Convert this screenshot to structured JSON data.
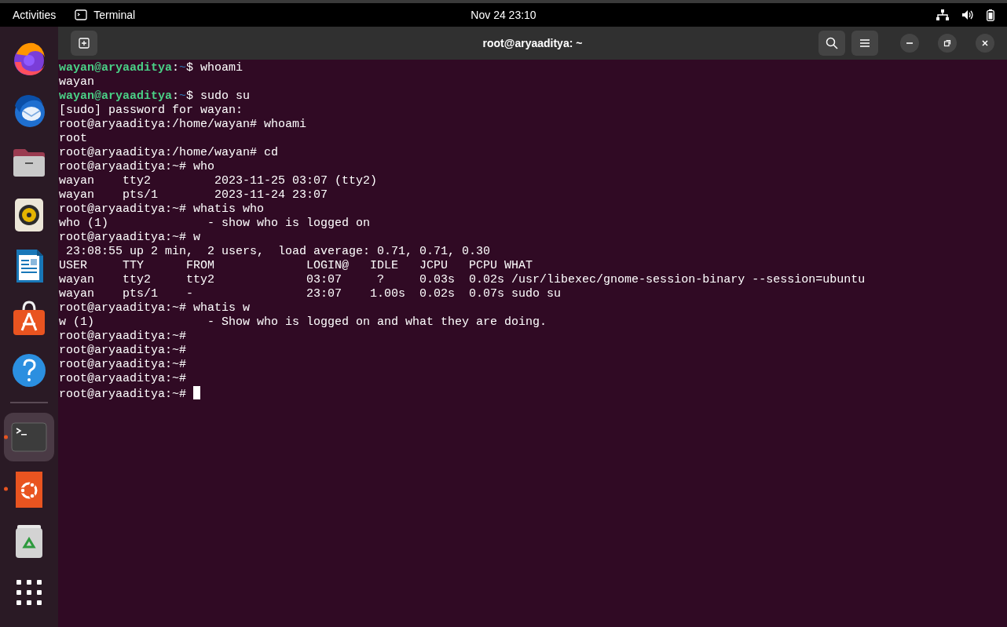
{
  "top_bar": {
    "activities": "Activities",
    "app_menu": "Terminal",
    "clock": "Nov 24  23:10"
  },
  "dock": {
    "items": [
      {
        "kind": "browser",
        "selected": false,
        "running": false
      },
      {
        "kind": "mail",
        "selected": false,
        "running": false
      },
      {
        "kind": "files",
        "selected": false,
        "running": false
      },
      {
        "kind": "music",
        "selected": false,
        "running": false
      },
      {
        "kind": "writer",
        "selected": false,
        "running": false
      },
      {
        "kind": "store",
        "selected": false,
        "running": false
      },
      {
        "kind": "help",
        "selected": false,
        "running": false
      },
      {
        "kind": "separator"
      },
      {
        "kind": "terminal",
        "selected": true,
        "running": true
      },
      {
        "kind": "ubuntu",
        "selected": false,
        "running": true
      },
      {
        "kind": "trash",
        "selected": false,
        "running": false
      },
      {
        "kind": "grid",
        "selected": false,
        "running": false
      }
    ]
  },
  "window": {
    "title": "root@aryaaditya: ~"
  },
  "terminal": {
    "lines": [
      {
        "kind": "prompt",
        "user": "wayan@aryaaditya",
        "sep": ":",
        "path": "~",
        "command": "$ whoami"
      },
      {
        "kind": "output",
        "text": "wayan"
      },
      {
        "kind": "prompt",
        "user": "wayan@aryaaditya",
        "sep": ":",
        "path": "~",
        "command": "$ sudo su"
      },
      {
        "kind": "output",
        "text": "[sudo] password for wayan:"
      },
      {
        "kind": "output",
        "text": "root@aryaaditya:/home/wayan# whoami"
      },
      {
        "kind": "output",
        "text": "root"
      },
      {
        "kind": "output",
        "text": "root@aryaaditya:/home/wayan# cd"
      },
      {
        "kind": "output",
        "text": "root@aryaaditya:~# who"
      },
      {
        "kind": "output",
        "text": "wayan    tty2         2023-11-25 03:07 (tty2)"
      },
      {
        "kind": "output",
        "text": "wayan    pts/1        2023-11-24 23:07"
      },
      {
        "kind": "output",
        "text": "root@aryaaditya:~# whatis who"
      },
      {
        "kind": "output",
        "text": "who (1)              - show who is logged on"
      },
      {
        "kind": "output",
        "text": "root@aryaaditya:~# w"
      },
      {
        "kind": "output",
        "text": " 23:08:55 up 2 min,  2 users,  load average: 0.71, 0.71, 0.30"
      },
      {
        "kind": "output",
        "text": "USER     TTY      FROM             LOGIN@   IDLE   JCPU   PCPU WHAT"
      },
      {
        "kind": "output",
        "text": "wayan    tty2     tty2             03:07     ?     0.03s  0.02s /usr/libexec/gnome-session-binary --session=ubuntu"
      },
      {
        "kind": "output",
        "text": "wayan    pts/1    -                23:07    1.00s  0.02s  0.07s sudo su"
      },
      {
        "kind": "output",
        "text": "root@aryaaditya:~# whatis w"
      },
      {
        "kind": "output",
        "text": "w (1)                - Show who is logged on and what they are doing."
      },
      {
        "kind": "output",
        "text": "root@aryaaditya:~#"
      },
      {
        "kind": "output",
        "text": "root@aryaaditya:~#"
      },
      {
        "kind": "output",
        "text": "root@aryaaditya:~#"
      },
      {
        "kind": "output",
        "text": "root@aryaaditya:~#"
      },
      {
        "kind": "output",
        "text": "root@aryaaditya:~# ",
        "cursor": true
      }
    ]
  }
}
